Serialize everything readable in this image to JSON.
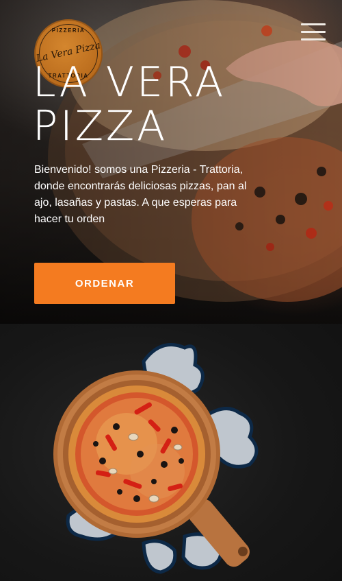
{
  "logo": {
    "top_text": "PIZZERIA",
    "script_text": "La Vera Pizza",
    "bottom_text": "TRATTORIA"
  },
  "header": {
    "menu_icon": "hamburger-menu-icon"
  },
  "hero": {
    "title": "LA VERA PIZZA",
    "description": "Bienvenido! somos una Pizzeria - Trattoria, donde encontrarás deliciosas pizzas, pan al ajo, lasañas y pastas. A que esperas para hacer tu orden",
    "cta_label": "ORDENAR"
  },
  "colors": {
    "accent": "#f47b20",
    "logo": "#c47422",
    "dark_background": "#161616"
  }
}
